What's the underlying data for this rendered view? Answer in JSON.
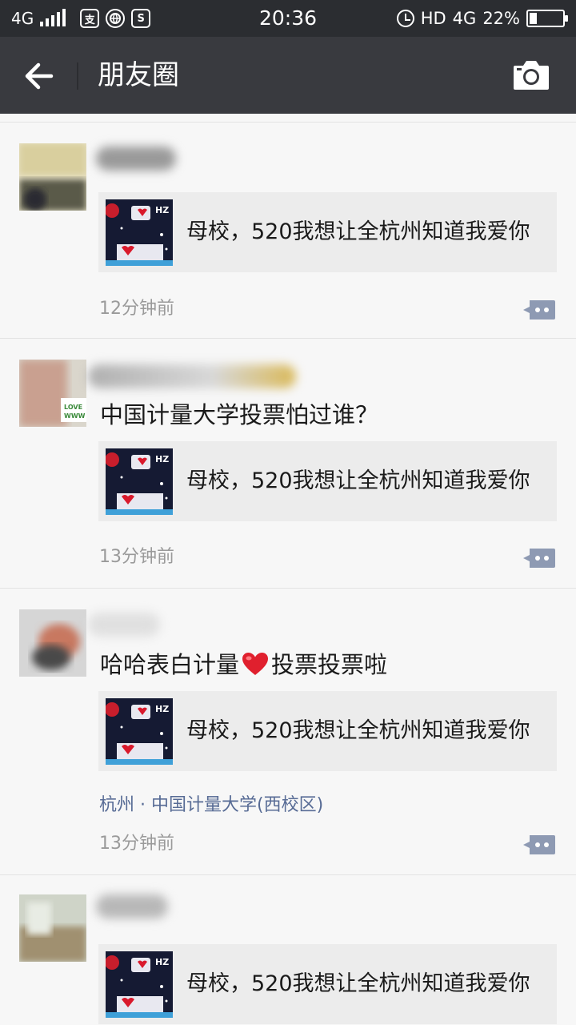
{
  "status_bar": {
    "network_left": "4G",
    "app_icon_1": "支",
    "app_icon_2": "S",
    "time": "20:36",
    "hd": "HD",
    "network_right": "4G",
    "battery": "22%",
    "battery_level": 0.22
  },
  "nav": {
    "back_icon": "arrow-left-icon",
    "title": "朋友圈",
    "camera_icon": "camera-icon"
  },
  "posts": [
    {
      "text": "",
      "link_title": "母校，520我想让全杭州知道我爱你",
      "location": "",
      "time": "12分钟前"
    },
    {
      "text": "中国计量大学投票怕过谁？",
      "link_title": "母校，520我想让全杭州知道我爱你",
      "location": "",
      "time": "13分钟前"
    },
    {
      "text_before": "哈哈表白计量",
      "text_after": "投票投票啦",
      "emoji": "red-heart-emoji",
      "link_title": "母校，520我想让全杭州知道我爱你",
      "location": "杭州 · 中国计量大学(西校区)",
      "time": "13分钟前"
    },
    {
      "text": "",
      "link_title": "母校，520我想让全杭州知道我爱你",
      "location": "",
      "time": ""
    }
  ],
  "thumb_label": "HZ",
  "colors": {
    "status_bar": "#2b2d31",
    "nav_bar": "#393a3f",
    "feed_bg": "#f7f7f7",
    "link_card": "#ececec",
    "link_blue": "#576b95",
    "comment_button": "#8e9ab3"
  }
}
